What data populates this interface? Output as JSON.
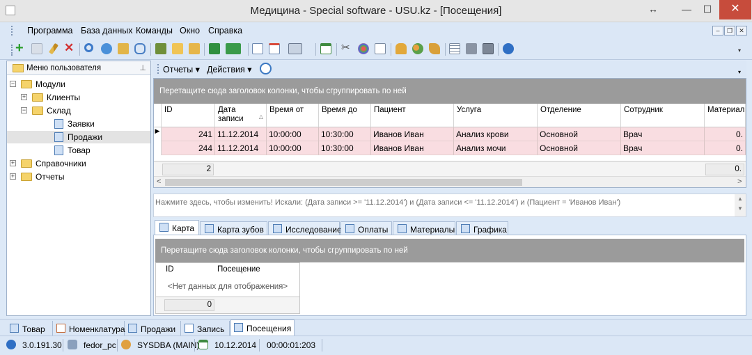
{
  "window": {
    "title": "Медицина - Special software - USU.kz - [Посещения]",
    "resize_glyph": "↔",
    "min_glyph": "—",
    "max_glyph": "☐",
    "close_glyph": "✕"
  },
  "menu": {
    "items": [
      "Программа",
      "База данных",
      "Команды",
      "Окно",
      "Справка"
    ],
    "mdi_min": "–",
    "mdi_restore": "❐",
    "mdi_close": "✕"
  },
  "toolbar": {
    "icons": [
      "add-icon",
      "copy-icon",
      "edit-icon",
      "delete-icon",
      "search-icon",
      "refresh-icon",
      "import-icon",
      "comment-icon",
      "filter-icon",
      "tree-icon",
      "export-icon",
      "excel-icon",
      "excel-dropdown-icon",
      "new-window-icon",
      "close-window-icon",
      "print-preview-icon",
      "calendar-icon",
      "tools-icon",
      "palette-icon",
      "edit-form-icon",
      "lock-icon",
      "users-icon",
      "brush-icon",
      "grid-icon",
      "printer-icon",
      "video-icon",
      "help-icon"
    ],
    "more_glyph": "▾"
  },
  "left_panel": {
    "title": "Меню пользователя",
    "pin_glyph": "⊥",
    "tree": [
      {
        "label": "Модули",
        "expander": "−",
        "type": "folder",
        "level": 0
      },
      {
        "label": "Клиенты",
        "expander": "+",
        "type": "folder",
        "level": 1
      },
      {
        "label": "Склад",
        "expander": "−",
        "type": "folder",
        "level": 1
      },
      {
        "label": "Заявки",
        "expander": "",
        "type": "doc",
        "level": 2
      },
      {
        "label": "Продажи",
        "expander": "",
        "type": "doc",
        "level": 2,
        "selected": true
      },
      {
        "label": "Товар",
        "expander": "",
        "type": "doc",
        "level": 2
      },
      {
        "label": "Справочники",
        "expander": "+",
        "type": "folder",
        "level": 0
      },
      {
        "label": "Отчеты",
        "expander": "+",
        "type": "folder",
        "level": 0
      }
    ]
  },
  "right_toolbar": {
    "reports": "Отчеты ▾",
    "actions": "Действия ▾",
    "more_glyph": "▾"
  },
  "grid": {
    "group_hint": "Перетащите сюда заголовок колонки, чтобы сгруппировать по ней",
    "columns": [
      "ID",
      "Дата записи",
      "Время от",
      "Время до",
      "Пациент",
      "Услуга",
      "Отделение",
      "Сотрудник",
      "Материалы"
    ],
    "sort_glyph": "△",
    "row_indicator": "▶",
    "rows": [
      [
        "241",
        "11.12.2014",
        "10:00:00",
        "10:30:00",
        "Иванов Иван",
        "Анализ крови",
        "Основной",
        "Врач",
        "0."
      ],
      [
        "244",
        "11.12.2014",
        "10:00:00",
        "10:30:00",
        "Иванов Иван",
        "Анализ мочи",
        "Основной",
        "Врач",
        "0."
      ]
    ],
    "footer_count": "2",
    "footer_materials": "0.",
    "scroll_left": "<",
    "scroll_right": ">"
  },
  "filter": {
    "text": "Нажмите здесь, чтобы изменить! Искали: (Дата записи  >= '11.12.2014') и (Дата записи  <= '11.12.2014') и (Пациент = 'Иванов Иван')",
    "scroll_up": "▲",
    "scroll_down": "▼"
  },
  "detail_tabs": [
    "Карта",
    "Карта зубов",
    "Исследование",
    "Оплаты",
    "Материалы",
    "Графика"
  ],
  "detail": {
    "group_hint": "Перетащите сюда заголовок колонки, чтобы сгруппировать по ней",
    "col_id": "ID",
    "col_visit": "Посещение",
    "empty": "<Нет данных для отображения>",
    "footer_count": "0"
  },
  "mdi_tabs": [
    "Товар",
    "Номенклатура",
    "Продажи",
    "Запись",
    "Посещения"
  ],
  "status": {
    "version": "3.0.191.30",
    "computer": "fedor_pc",
    "user": "SYSDBA (MAIN)",
    "date": "10.12.2014",
    "timer": "00:00:01:203"
  },
  "colors": {
    "chrome": "#dbe7f6",
    "row_highlight": "#f9dde1",
    "group_panel": "#9b9b9b",
    "close_button": "#c74c3c"
  }
}
